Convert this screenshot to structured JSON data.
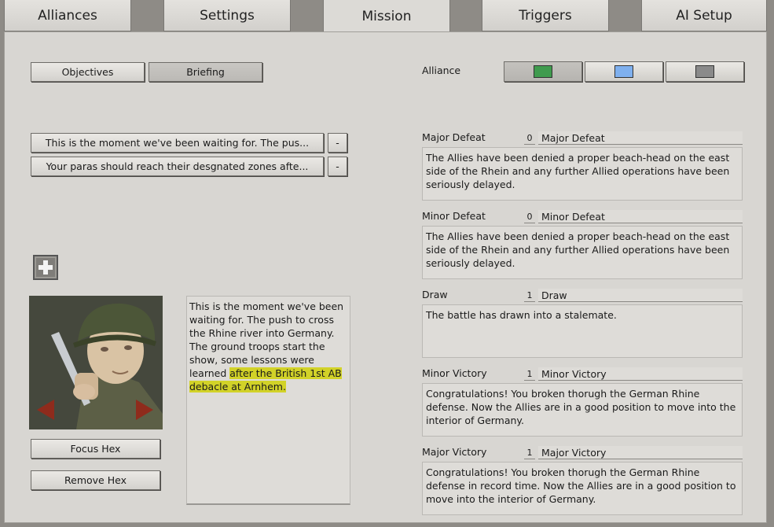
{
  "tabs": [
    {
      "label": "Alliances"
    },
    {
      "label": "Settings"
    },
    {
      "label": "Mission"
    },
    {
      "label": "Triggers"
    },
    {
      "label": "AI Setup"
    }
  ],
  "mode_buttons": {
    "objectives": "Objectives",
    "briefing": "Briefing"
  },
  "alliance": {
    "label": "Alliance",
    "swatch_colors": [
      "#3f9b4e",
      "#7fb0ee",
      "#8a8a8a"
    ]
  },
  "briefing_entries": [
    {
      "text": "This is the moment we've been waiting for. The pus...",
      "remove": "-"
    },
    {
      "text": "Your paras should reach their desgnated zones afte...",
      "remove": "-"
    }
  ],
  "add_icon": "plus-icon",
  "portrait": {
    "left_arrow": "arrow-left-icon",
    "right_arrow": "arrow-right-icon"
  },
  "briefing_text": {
    "normal": "This is the moment we've been waiting for. The push to cross the Rhine river into Germany. The ground troops start the show, some lessons were learned ",
    "highlight": "after the British 1st AB debacle at Arnhem."
  },
  "hex_buttons": {
    "focus": "Focus Hex",
    "remove": "Remove Hex"
  },
  "outcomes": [
    {
      "label": "Major Defeat",
      "value": "0",
      "name": "Major Defeat",
      "text": "The Allies have been denied a proper beach-head on the east side of the Rhein and any further Allied operations have been seriously delayed."
    },
    {
      "label": "Minor Defeat",
      "value": "0",
      "name": "Minor Defeat",
      "text": "The Allies have been denied a proper beach-head on the east side of the Rhein and any further Allied operations have been seriously delayed."
    },
    {
      "label": "Draw",
      "value": "1",
      "name": "Draw",
      "text": "The battle has drawn into a stalemate."
    },
    {
      "label": "Minor Victory",
      "value": "1",
      "name": "Minor Victory",
      "text": "Congratulations! You broken thorugh the German Rhine defense. Now the Allies are in a good position to move into the interior of Germany."
    },
    {
      "label": "Major Victory",
      "value": "1",
      "name": "Major Victory",
      "text": "Congratulations! You broken thorugh the German Rhine defense in record time. Now the Allies are in a good position to move into the interior of Germany."
    }
  ]
}
